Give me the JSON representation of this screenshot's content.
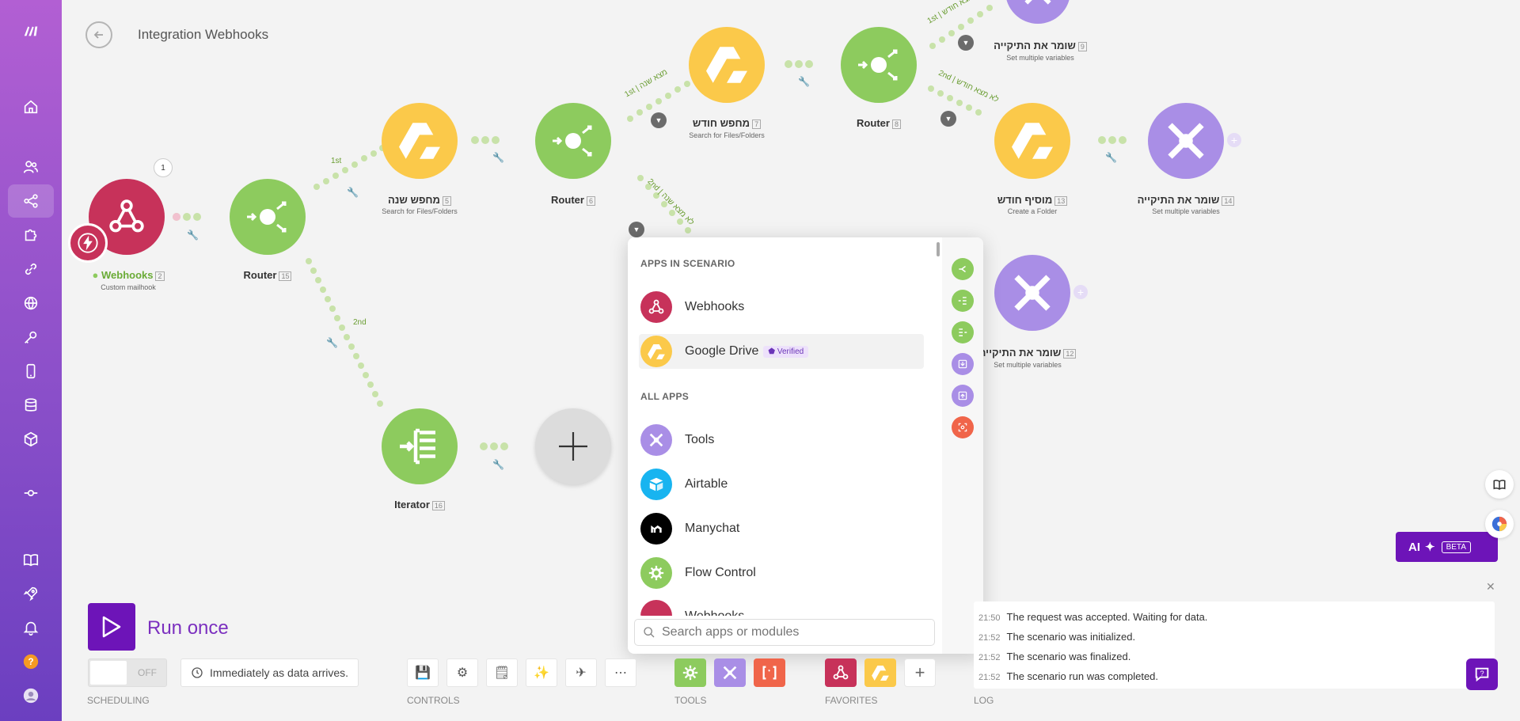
{
  "colors": {
    "accent": "#6d14b8",
    "router_green": "#8dcb5e",
    "drive_yellow": "#fbc94a",
    "tools_purple": "#a98ee6",
    "webhook_red": "#c7325a",
    "log_orange": "#f08a24"
  },
  "header": {
    "title": "Integration Webhooks"
  },
  "nodes": {
    "webhooks": {
      "label": "Webhooks",
      "num": "2",
      "sub": "Custom mailhook",
      "badge": "1"
    },
    "router15": {
      "label": "Router",
      "num": "15"
    },
    "search_year": {
      "label": "מחפש שנה",
      "num": "5",
      "sub": "Search for Files/Folders"
    },
    "router6": {
      "label": "Router",
      "num": "6"
    },
    "search_month": {
      "label": "מחפש חודש",
      "num": "7",
      "sub": "Search for Files/Folders"
    },
    "router8": {
      "label": "Router",
      "num": "8"
    },
    "save_folder_top": {
      "label": "שומר את התיקייה",
      "num": "9",
      "sub": "Set multiple variables"
    },
    "add_month": {
      "label": "מוסיף חודש",
      "num": "13",
      "sub": "Create a Folder"
    },
    "save_folder_right": {
      "label": "שומר את התיקייה",
      "num": "14",
      "sub": "Set multiple variables"
    },
    "save_folder_mid": {
      "label": "שומר את התיקייה",
      "num": "12",
      "sub": "Set multiple variables"
    },
    "iterator": {
      "label": "Iterator",
      "num": "16"
    }
  },
  "routes": {
    "r15_1st": "1st",
    "r15_2nd": "2nd",
    "r6_1st": "1st | מצא שנה",
    "r6_2nd": "2nd | לא מצא שנה",
    "r8_1st": "1st | מצא חודש",
    "r8_2nd": "2nd | לא מצא חודש"
  },
  "picker": {
    "section_scenario": "APPS IN SCENARIO",
    "section_all": "ALL APPS",
    "scenario_apps": [
      {
        "name": "Webhooks",
        "icon": "webhook-icon"
      },
      {
        "name": "Google Drive",
        "icon": "google-drive-icon",
        "badge": "Verified"
      }
    ],
    "all_apps": [
      {
        "name": "Tools",
        "icon": "tools-icon"
      },
      {
        "name": "Airtable",
        "icon": "airtable-icon"
      },
      {
        "name": "Manychat",
        "icon": "manychat-icon"
      },
      {
        "name": "Flow Control",
        "icon": "flow-control-icon"
      },
      {
        "name": "Webhooks",
        "icon": "webhook-icon"
      }
    ],
    "search_placeholder": "Search apps or modules"
  },
  "bottom": {
    "run_label": "Run once",
    "toggle_state": "OFF",
    "schedule_text": "Immediately as data arrives.",
    "sections": {
      "scheduling": "SCHEDULING",
      "controls": "CONTROLS",
      "tools": "TOOLS",
      "favorites": "FAVORITES",
      "log": "LOG"
    }
  },
  "log": [
    {
      "time": "21:50",
      "text": "The request was accepted. Waiting for data."
    },
    {
      "time": "21:52",
      "text": "The scenario was initialized."
    },
    {
      "time": "21:52",
      "text": "The scenario was finalized."
    },
    {
      "time": "21:52",
      "text": "The scenario run was completed."
    }
  ],
  "ai": {
    "label": "AI",
    "beta": "BETA"
  }
}
